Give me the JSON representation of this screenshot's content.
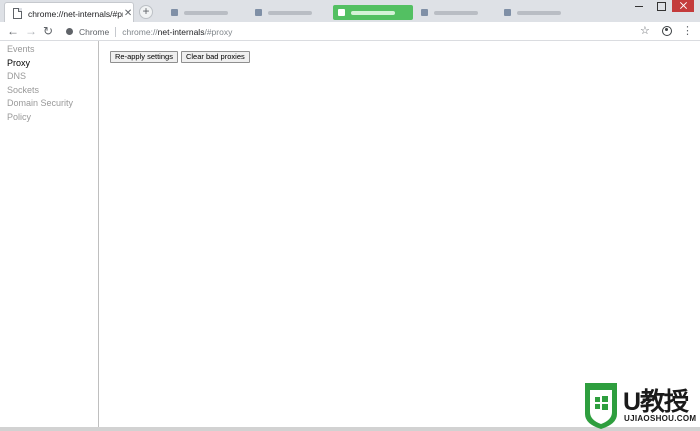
{
  "tab": {
    "title": "chrome://net-internals/#proxy",
    "close_glyph": "✕"
  },
  "new_tab_glyph": "+",
  "omnibox": {
    "chip_label": "Chrome",
    "url_scheme": "chrome://",
    "url_host": "net-internals",
    "url_path": "/#proxy"
  },
  "toolbar": {
    "back_glyph": "←",
    "forward_glyph": "→",
    "reload_glyph": "↻",
    "star_glyph": "☆",
    "menu_glyph": "⋮"
  },
  "sidebar": {
    "items": [
      {
        "label": "Events",
        "selected": false
      },
      {
        "label": "Proxy",
        "selected": true
      },
      {
        "label": "DNS",
        "selected": false
      },
      {
        "label": "Sockets",
        "selected": false
      },
      {
        "label": "Domain Security Policy",
        "selected": false
      }
    ]
  },
  "main": {
    "reapply_label": "Re-apply settings",
    "clear_label": "Clear bad proxies"
  },
  "watermark": {
    "brand": "U教授",
    "sub": "UJIAOSHOU.COM"
  },
  "colors": {
    "watermark_green": "#2e9e3e",
    "highlight_tab_green": "#53c062"
  }
}
